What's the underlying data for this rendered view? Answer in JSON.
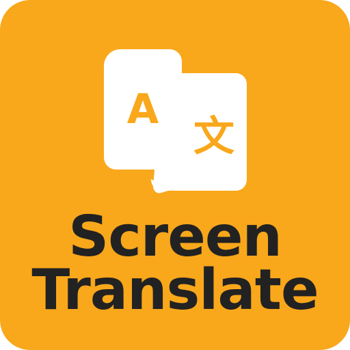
{
  "app": {
    "title_line_1": "Screen",
    "title_line_2": "Translate",
    "letter_a": "A",
    "letter_cjk": "文",
    "icon": "translate-icon"
  },
  "colors": {
    "background": "#F9A71B",
    "text": "#222222",
    "card": "#FFFFFF"
  }
}
